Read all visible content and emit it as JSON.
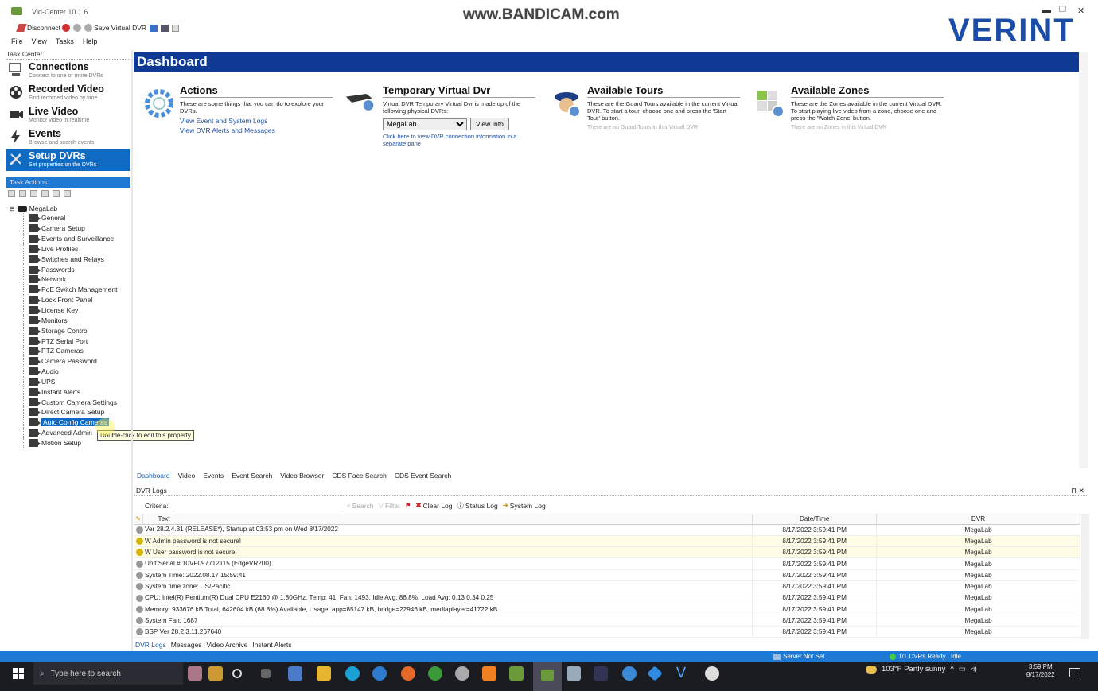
{
  "app": {
    "title": "Vid-Center 10.1.6",
    "watermark": "www.BANDICAM.com",
    "brand": "VERINT"
  },
  "toolbar": {
    "disconnect": "Disconnect",
    "save_virtual_dvr": "Save Virtual DVR"
  },
  "menu": [
    "File",
    "View",
    "Tasks",
    "Help"
  ],
  "task_center": {
    "label": "Task Center"
  },
  "nav": [
    {
      "title": "Connections",
      "sub": "Connect to one or more DVRs"
    },
    {
      "title": "Recorded Video",
      "sub": "Find recorded video by time"
    },
    {
      "title": "Live Video",
      "sub": "Monitor video in realtime"
    },
    {
      "title": "Events",
      "sub": "Browse and search events"
    },
    {
      "title": "Setup DVRs",
      "sub": "Set properties on the DVRs"
    }
  ],
  "task_actions": {
    "label": "Task Actions"
  },
  "tree": {
    "root": "MegaLab",
    "items": [
      "General",
      "Camera Setup",
      "Events and Surveillance",
      "Live Profiles",
      "Switches and Relays",
      "Passwords",
      "Network",
      "PoE Switch Management",
      "Lock Front Panel",
      "License Key",
      "Monitors",
      "Storage Control",
      "PTZ Serial Port",
      "PTZ Cameras",
      "Camera Password",
      "Audio",
      "UPS",
      "Instant Alerts",
      "Custom Camera Settings",
      "Direct Camera Setup",
      "Auto Config Cameras",
      "Advanced Admin",
      "Motion Setup"
    ],
    "tooltip": "Double-click to edit this property"
  },
  "dashboard": {
    "title": "Dashboard",
    "actions": {
      "title": "Actions",
      "text": "These are some things that you can do to explore your DVRs.",
      "link1": "View Event and System Logs",
      "link2": "View DVR Alerts and Messages"
    },
    "tvd": {
      "title": "Temporary Virtual Dvr",
      "text": "Virtual DVR Temporary Virtual Dvr is made up of the following physical DVRs:",
      "selected": "MegaLab",
      "button": "View Info",
      "link": "Click here to view DVR connection information in a separate pane"
    },
    "tours": {
      "title": "Available Tours",
      "text": "These are the Guard Tours available in the current Virtual DVR. To start a tour, choose one and press the 'Start Tour' button.",
      "empty": "There are no Guard Tours in this Virtual DVR"
    },
    "zones": {
      "title": "Available Zones",
      "text": "These are the Zones available in the current Virtual DVR. To start playing live video from a zone, choose one and press the 'Watch Zone' button.",
      "empty": "There are no Zones in this Virtual DVR"
    }
  },
  "view_tabs": [
    "Dashboard",
    "Video",
    "Events",
    "Event Search",
    "Video Browser",
    "CDS Face Search",
    "CDS Event Search"
  ],
  "logs": {
    "title": "DVR Logs",
    "pin": "⊓ ✕",
    "criteria_label": "Criteria:",
    "search": "Search",
    "filter": "Filter",
    "clear_log": "Clear Log",
    "status_log": "Status Log",
    "system_log": "System Log",
    "columns": {
      "text": "Text",
      "datetime": "Date/Time",
      "dvr": "DVR"
    },
    "rows": [
      {
        "text": "Ver 28.2.4.31 (RELEASE*), Startup at 03:53 pm on Wed 8/17/2022",
        "dt": "8/17/2022 3:59:41 PM",
        "dvr": "MegaLab"
      },
      {
        "text": "W Admin password is not secure!",
        "dt": "8/17/2022 3:59:41 PM",
        "dvr": "MegaLab"
      },
      {
        "text": "W User password is not secure!",
        "dt": "8/17/2022 3:59:41 PM",
        "dvr": "MegaLab"
      },
      {
        "text": "Unit Serial # 10VF097712115 (EdgeVR200)",
        "dt": "8/17/2022 3:59:41 PM",
        "dvr": "MegaLab"
      },
      {
        "text": "System Time: 2022.08.17 15:59:41",
        "dt": "8/17/2022 3:59:41 PM",
        "dvr": "MegaLab"
      },
      {
        "text": "System time zone: US/Pacific",
        "dt": "8/17/2022 3:59:41 PM",
        "dvr": "MegaLab"
      },
      {
        "text": "CPU: Intel(R) Pentium(R) Dual CPU E2160 @ 1.80GHz, Temp: 41, Fan: 1493, Idle Avg: 86.8%, Load Avg: 0.13 0.34 0.25",
        "dt": "8/17/2022 3:59:41 PM",
        "dvr": "MegaLab"
      },
      {
        "text": "Memory: 933676 kB Total, 642604 kB (68.8%) Available, Usage: app=85147 kB, bridge=22946 kB, mediaplayer=41722 kB",
        "dt": "8/17/2022 3:59:41 PM",
        "dvr": "MegaLab"
      },
      {
        "text": "System Fan: 1687",
        "dt": "8/17/2022 3:59:41 PM",
        "dvr": "MegaLab"
      },
      {
        "text": "BSP Ver 28.2.3.11.267640",
        "dt": "8/17/2022 3:59:41 PM",
        "dvr": "MegaLab"
      }
    ]
  },
  "bottom_tabs": [
    "DVR Logs",
    "Messages",
    "Video Archive",
    "Instant Alerts"
  ],
  "status": {
    "server": "Server Not Set",
    "dvrs": "1/1 DVRs Ready",
    "state": "Idle"
  },
  "taskbar": {
    "search_placeholder": "Type here to search",
    "weather": "103°F  Partly sunny",
    "time": "3:59 PM",
    "date": "8/17/2022"
  },
  "colors": {
    "nav_active": "#0f6ac4",
    "dash_header": "#0f3a94",
    "status_bar": "#1f78d1",
    "brand": "#1a4ca8"
  }
}
